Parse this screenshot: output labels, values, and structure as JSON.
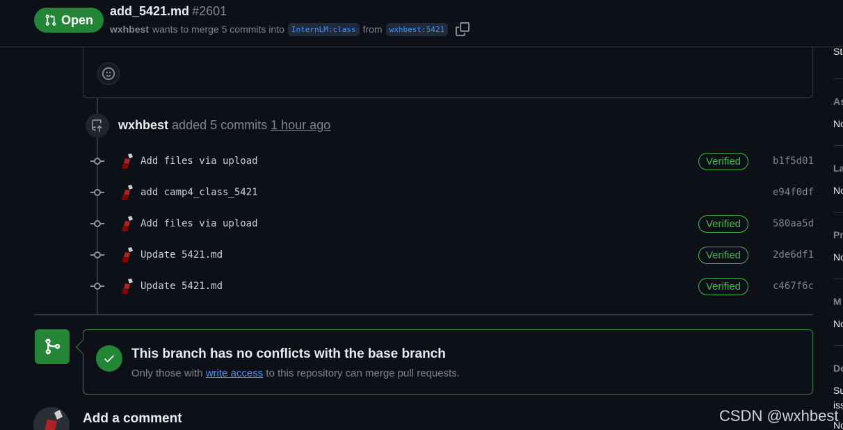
{
  "header": {
    "state": "Open",
    "title": "add_5421.md",
    "number": "#2601",
    "author": "wxhbest",
    "merge_text": "wants to merge 5 commits into",
    "base_branch": "InternLM:class",
    "from_text": "from",
    "head_branch": "wxhbest:5421"
  },
  "sidebar": {
    "labels": [
      "St",
      "As",
      "No",
      "La",
      "No",
      "Pr",
      "No",
      "M",
      "No",
      "De",
      "Su",
      "iss",
      "No"
    ]
  },
  "timeline": {
    "event": {
      "author": "wxhbest",
      "action": "added 5 commits",
      "time": "1 hour ago"
    },
    "commits": [
      {
        "message": "Add files via upload",
        "verified": "Verified",
        "sha": "b1f5d01"
      },
      {
        "message": "add camp4_class_5421",
        "verified": "",
        "sha": "e94f0df"
      },
      {
        "message": "Add files via upload",
        "verified": "Verified",
        "sha": "580aa5d"
      },
      {
        "message": "Update 5421.md",
        "verified": "Verified",
        "sha": "2de6df1"
      },
      {
        "message": "Update 5421.md",
        "verified": "Verified",
        "sha": "c467f6c"
      }
    ]
  },
  "merge": {
    "title": "This branch has no conflicts with the base branch",
    "desc_before": "Only those with",
    "desc_link": "write access",
    "desc_after": "to this repository can merge pull requests."
  },
  "comment": {
    "title": "Add a comment"
  },
  "watermark": "CSDN @wxhbest",
  "colors": {
    "background": "#0d1117",
    "green": "#238636",
    "verified_green": "#3fb950",
    "link_blue": "#4493f8",
    "border": "#30363d"
  }
}
